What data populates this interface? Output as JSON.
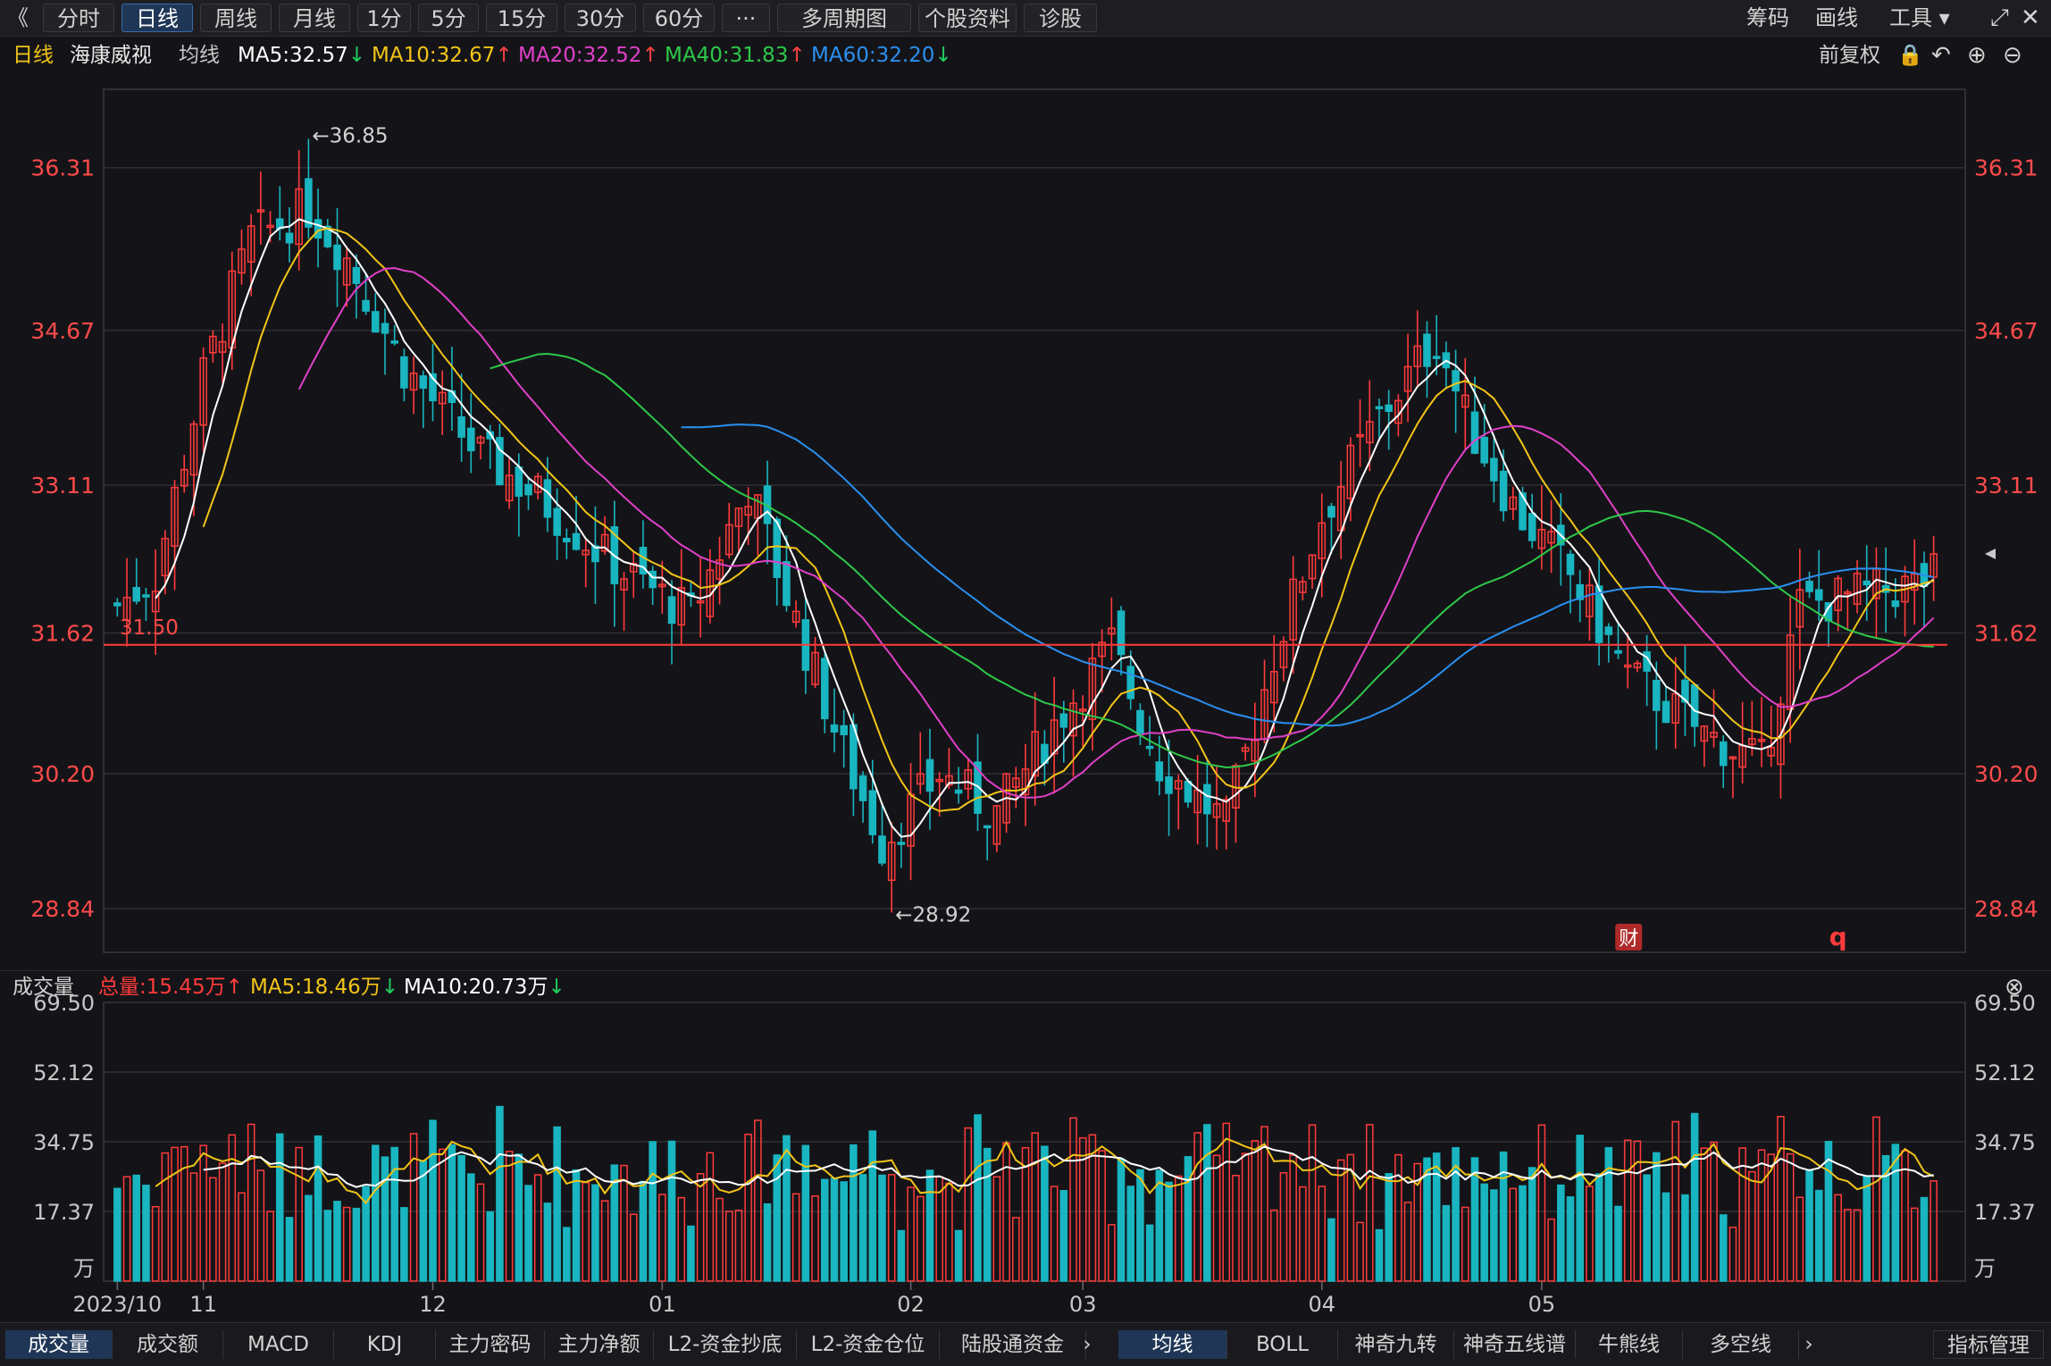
{
  "toolbar": {
    "back_glyph": "《",
    "periods": [
      "分时",
      "日线",
      "周线",
      "月线",
      "1分",
      "5分",
      "15分",
      "30分",
      "60分",
      "···",
      "多周期图",
      "个股资料",
      "诊股"
    ],
    "active_period": "日线",
    "right": [
      "筹码",
      "画线",
      "工具"
    ]
  },
  "ma_bar": {
    "kind": "日线",
    "stock": "海康威视",
    "label": "均线",
    "ma5": {
      "text": "MA5:32.57",
      "dir": "down"
    },
    "ma10": {
      "text": "MA10:32.67",
      "dir": "up"
    },
    "ma20": {
      "text": "MA20:32.52",
      "dir": "up"
    },
    "ma40": {
      "text": "MA40:31.83",
      "dir": "up"
    },
    "ma60": {
      "text": "MA60:32.20",
      "dir": "down"
    },
    "adjust": "前复权"
  },
  "vol_bar": {
    "label": "成交量",
    "total": {
      "text": "总量:15.45万",
      "dir": "up"
    },
    "ma5": {
      "text": "MA5:18.46万",
      "dir": "down"
    },
    "ma10": {
      "text": "MA10:20.73万",
      "dir": "down"
    }
  },
  "bottom_tabs_left": [
    "成交量",
    "成交额",
    "MACD",
    "KDJ",
    "主力密码",
    "主力净额",
    "L2-资金抄底",
    "L2-资金仓位",
    "陆股通资金"
  ],
  "bottom_tabs_right": [
    "均线",
    "BOLL",
    "神奇九转",
    "神奇五线谱",
    "牛熊线",
    "多空线"
  ],
  "bottom_manage": "指标管理",
  "colors": {
    "up": "#ff3b3b",
    "down": "#19b5c0",
    "ma5": "#ffffff",
    "ma10": "#f2c418",
    "ma20": "#e040c8",
    "ma40": "#2ec84a",
    "ma60": "#2a8ff0"
  },
  "chart_data": {
    "type": "candlestick",
    "price_ticks": [
      36.31,
      34.67,
      33.11,
      31.62,
      30.2,
      28.84
    ],
    "price_range": [
      28.4,
      37.1
    ],
    "volume_ticks": [
      "69.50",
      "52.12",
      "34.75",
      "17.37"
    ],
    "volume_unit": "万",
    "volume_range": [
      0,
      69.5
    ],
    "x_ticks": [
      {
        "label": "2023/10",
        "index": 0
      },
      {
        "label": "11",
        "index": 10
      },
      {
        "label": "12",
        "index": 37
      },
      {
        "label": "01",
        "index": 64
      },
      {
        "label": "02",
        "index": 93
      },
      {
        "label": "03",
        "index": 113
      },
      {
        "label": "04",
        "index": 141
      },
      {
        "label": "05",
        "index": 167
      }
    ],
    "annotations": {
      "high_label": "←36.85",
      "low_label": "←28.92",
      "line_label": "31.50",
      "line_value": 31.5,
      "badge_cai": "财",
      "badge_q": "q"
    },
    "bars": 191
  }
}
